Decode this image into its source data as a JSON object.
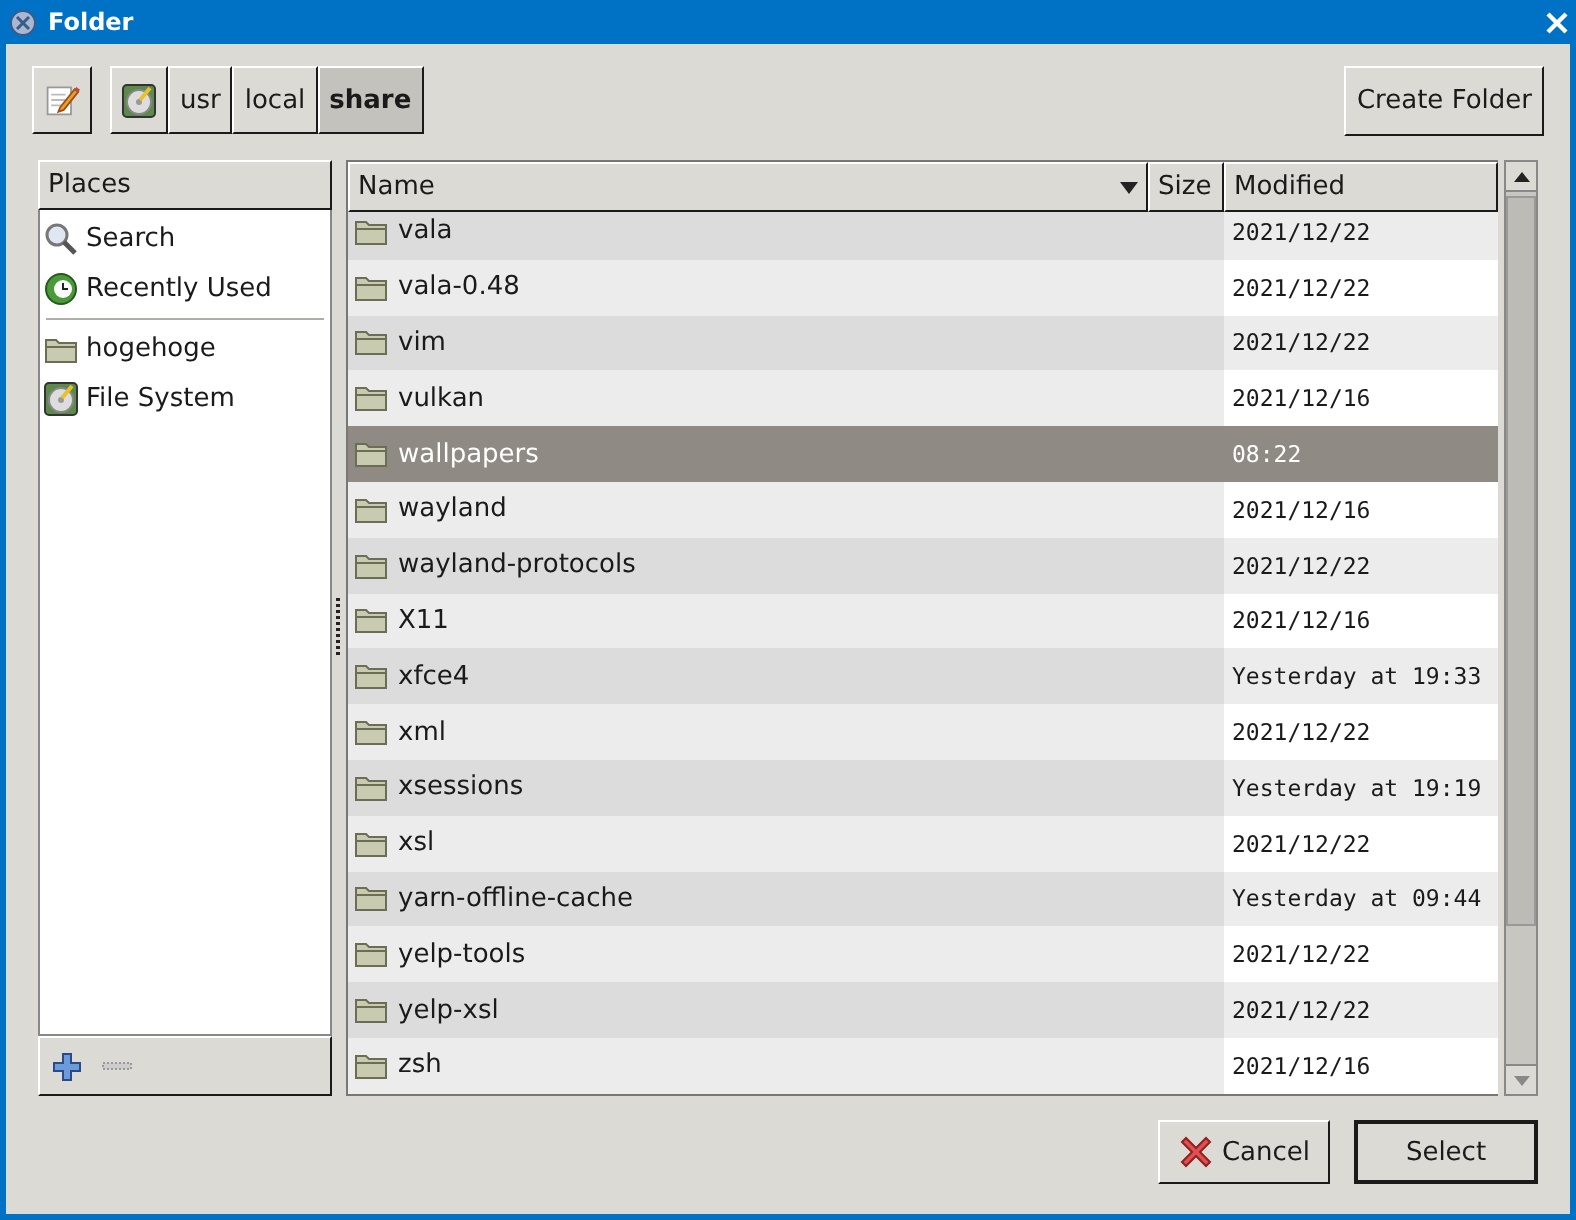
{
  "window": {
    "title": "Folder"
  },
  "path_bar": {
    "segments": [
      {
        "label": "usr",
        "selected": false
      },
      {
        "label": "local",
        "selected": false
      },
      {
        "label": "share",
        "selected": true
      }
    ]
  },
  "create_folder_button": "Create Folder",
  "places": {
    "header": "Places",
    "items": [
      {
        "kind": "search",
        "label": "Search"
      },
      {
        "kind": "recent",
        "label": "Recently Used"
      },
      {
        "kind": "separator"
      },
      {
        "kind": "folder",
        "label": "hogehoge"
      },
      {
        "kind": "drive",
        "label": "File System"
      }
    ]
  },
  "table": {
    "columns": [
      "Name",
      "Size",
      "Modified"
    ],
    "rows": [
      {
        "name": "vala",
        "modified": "2021/12/22",
        "selected": false
      },
      {
        "name": "vala-0.48",
        "modified": "2021/12/22",
        "selected": false
      },
      {
        "name": "vim",
        "modified": "2021/12/22",
        "selected": false
      },
      {
        "name": "vulkan",
        "modified": "2021/12/16",
        "selected": false
      },
      {
        "name": "wallpapers",
        "modified": "08:22",
        "selected": true
      },
      {
        "name": "wayland",
        "modified": "2021/12/16",
        "selected": false
      },
      {
        "name": "wayland-protocols",
        "modified": "2021/12/22",
        "selected": false
      },
      {
        "name": "X11",
        "modified": "2021/12/16",
        "selected": false
      },
      {
        "name": "xfce4",
        "modified": "Yesterday at 19:33",
        "selected": false
      },
      {
        "name": "xml",
        "modified": "2021/12/22",
        "selected": false
      },
      {
        "name": "xsessions",
        "modified": "Yesterday at 19:19",
        "selected": false
      },
      {
        "name": "xsl",
        "modified": "2021/12/22",
        "selected": false
      },
      {
        "name": "yarn-offline-cache",
        "modified": "Yesterday at 09:44",
        "selected": false
      },
      {
        "name": "yelp-tools",
        "modified": "2021/12/22",
        "selected": false
      },
      {
        "name": "yelp-xsl",
        "modified": "2021/12/22",
        "selected": false
      },
      {
        "name": "zsh",
        "modified": "2021/12/16",
        "selected": false
      }
    ]
  },
  "buttons": [
    {
      "kind": "cancel",
      "label": "Cancel"
    },
    {
      "kind": "select",
      "label": "Select"
    }
  ]
}
